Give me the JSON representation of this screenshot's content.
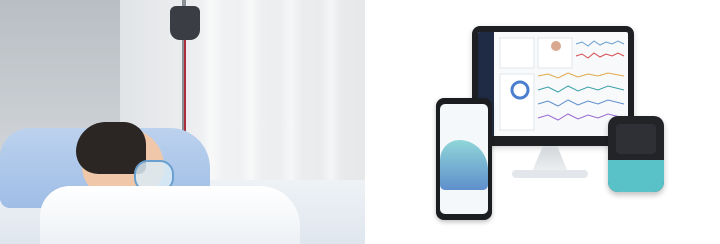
{
  "photo_left": {
    "subject": "child-patient-with-oxygen-mask"
  },
  "photo_right": {
    "subject": "remote-patient-monitoring-devices"
  },
  "colors": {
    "pillow": "#9fbde6",
    "iv_bag": "#3a3d44",
    "mask_strap": "#6aa0cf",
    "device_accent": "#58c2c8",
    "monitor_frame": "#1e1f23",
    "phone_frame": "#1c1d21",
    "wave_teal": "#8fd6d8",
    "wave_blue": "#5f8fcc"
  }
}
